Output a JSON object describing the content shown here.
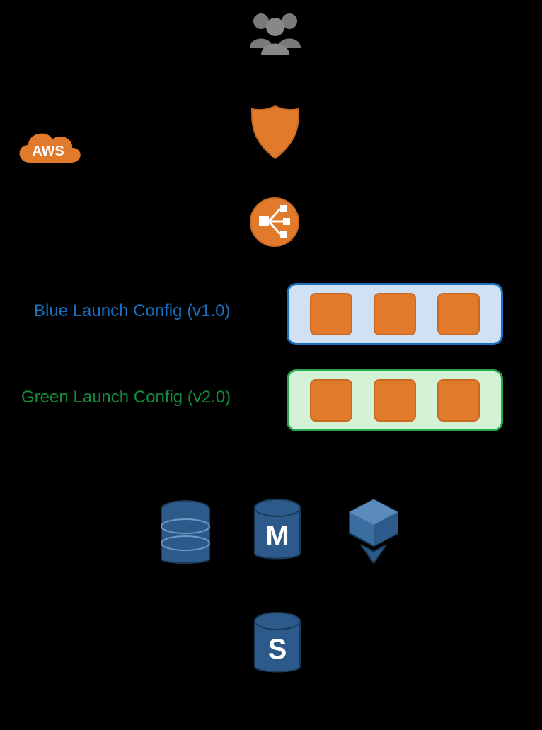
{
  "labels": {
    "cloud": "AWS",
    "blue": "Blue Launch Config (v1.0)",
    "green": "Green Launch Config (v2.0)",
    "rds_master": "M",
    "rds_standby": "S"
  },
  "colors": {
    "aws_orange": "#e27a2c",
    "aws_blue": "#2c5a8a",
    "asg_blue_border": "#1b6fbf",
    "asg_blue_fill": "#d0e0f5",
    "asg_green_border": "#2aa64f",
    "asg_green_fill": "#d6f2d6",
    "users_gray": "#7a7a7a"
  },
  "counts": {
    "blue_instances": 3,
    "green_instances": 3
  },
  "diagram": {
    "nodes": [
      {
        "id": "users",
        "type": "users"
      },
      {
        "id": "route53",
        "type": "route53"
      },
      {
        "id": "elb",
        "type": "elb"
      },
      {
        "id": "blue-asg",
        "type": "asg",
        "label_key": "blue",
        "instances": 3
      },
      {
        "id": "green-asg",
        "type": "asg",
        "label_key": "green",
        "instances": 3
      },
      {
        "id": "dynamodb",
        "type": "dynamodb"
      },
      {
        "id": "rds-master",
        "type": "rds",
        "letter": "M"
      },
      {
        "id": "elasticache",
        "type": "elasticache"
      },
      {
        "id": "rds-standby",
        "type": "rds",
        "letter": "S"
      },
      {
        "id": "aws-cloud",
        "type": "cloud",
        "label_key": "cloud"
      }
    ],
    "edges": [
      {
        "from": "users",
        "to": "route53"
      },
      {
        "from": "route53",
        "to": "elb"
      },
      {
        "from": "elb",
        "to": "blue-asg"
      },
      {
        "from": "green-asg",
        "to": "rds-master"
      },
      {
        "from": "rds-master",
        "to": "rds-standby"
      }
    ]
  }
}
